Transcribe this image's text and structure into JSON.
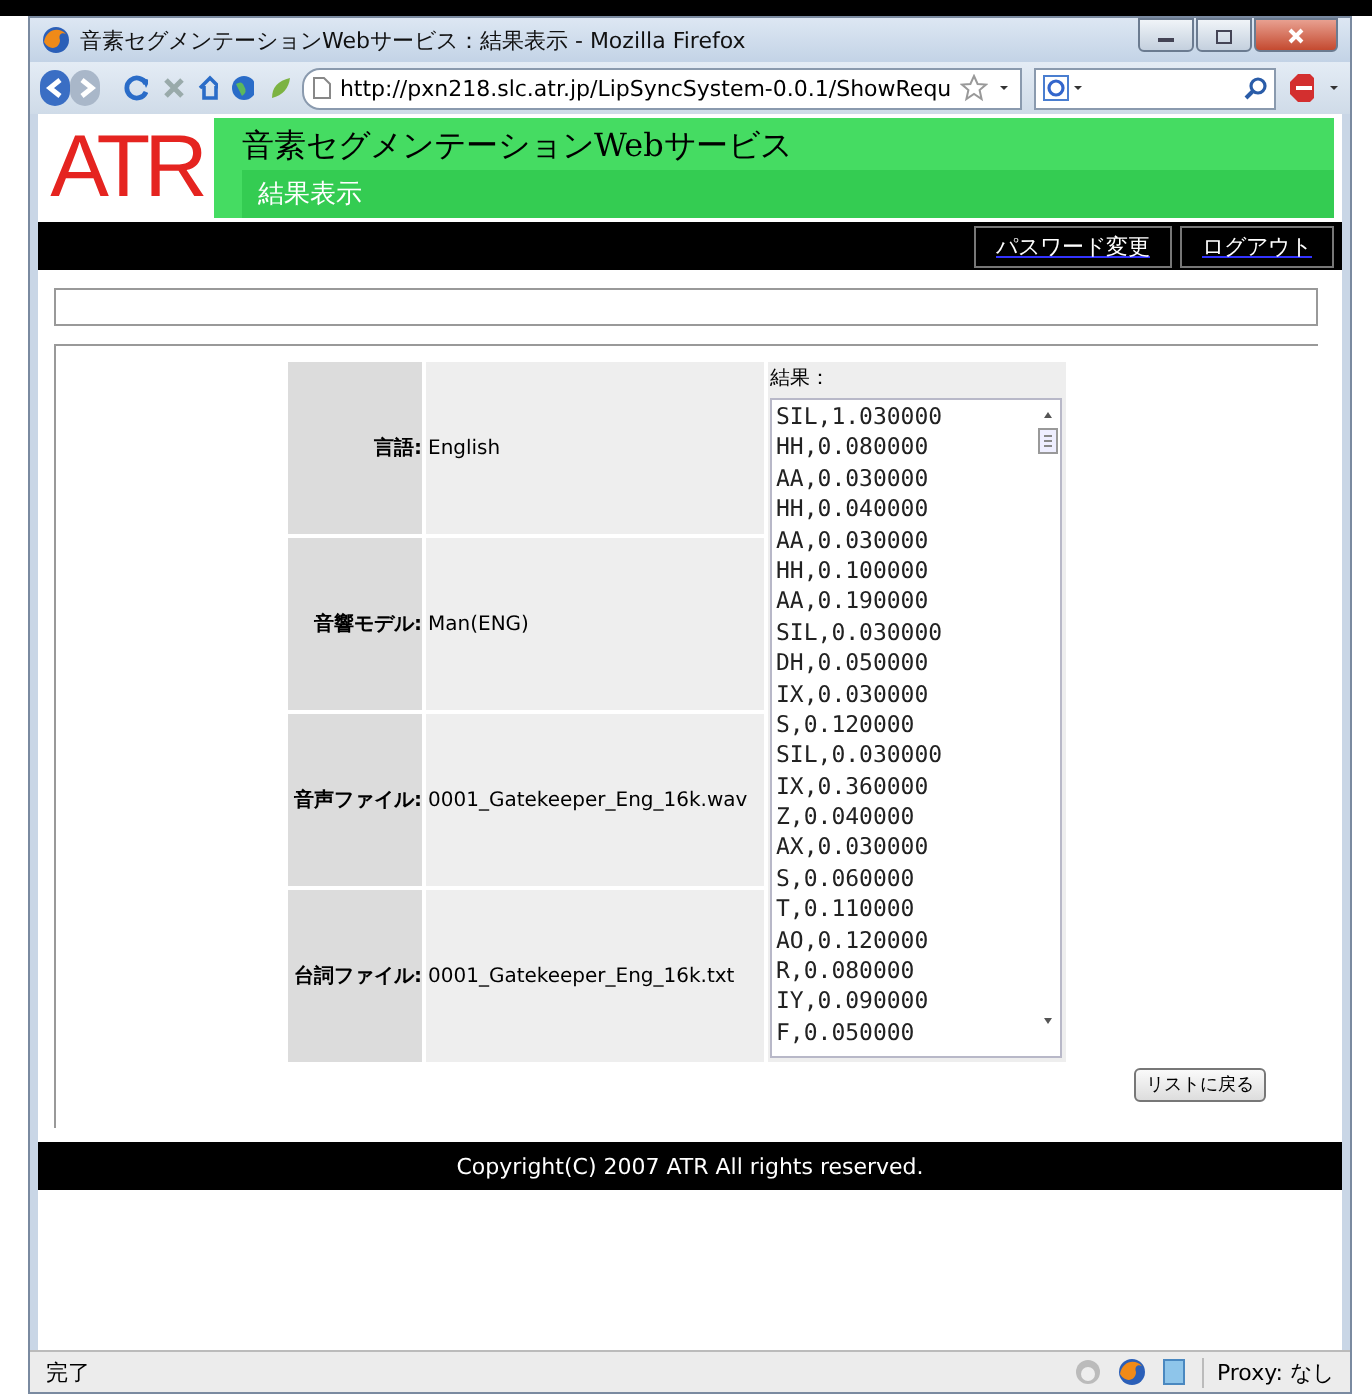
{
  "window": {
    "title": "音素セグメンテーションWebサービス：結果表示 - Mozilla Firefox"
  },
  "toolbar": {
    "url": "http://pxn218.slc.atr.jp/LipSyncSystem-0.0.1/ShowRequ"
  },
  "header": {
    "logo": "ATR",
    "title": "音素セグメンテーションWebサービス",
    "subtitle": "結果表示"
  },
  "nav": [
    "パスワード変更",
    "ログアウト"
  ],
  "details": [
    {
      "label": "言語:",
      "value": "English"
    },
    {
      "label": "音響モデル:",
      "value": "Man(ENG)"
    },
    {
      "label": "音声ファイル:",
      "value": "0001_Gatekeeper_Eng_16k.wav"
    },
    {
      "label": "台詞ファイル:",
      "value": "0001_Gatekeeper_Eng_16k.txt"
    }
  ],
  "result": {
    "label": "結果：",
    "lines": [
      "SIL,1.030000",
      "HH,0.080000",
      "AA,0.030000",
      "HH,0.040000",
      "AA,0.030000",
      "HH,0.100000",
      "AA,0.190000",
      "SIL,0.030000",
      "DH,0.050000",
      "IX,0.030000",
      "S,0.120000",
      "SIL,0.030000",
      "IX,0.360000",
      "Z,0.040000",
      "AX,0.030000",
      "S,0.060000",
      "T,0.110000",
      "AO,0.120000",
      "R,0.080000",
      "IY,0.090000",
      "F,0.050000"
    ]
  },
  "back_button": "リストに戻る",
  "footer": "Copyright(C) 2007 ATR All rights reserved.",
  "status_bar": {
    "text": "完了",
    "proxy": "Proxy: なし"
  }
}
